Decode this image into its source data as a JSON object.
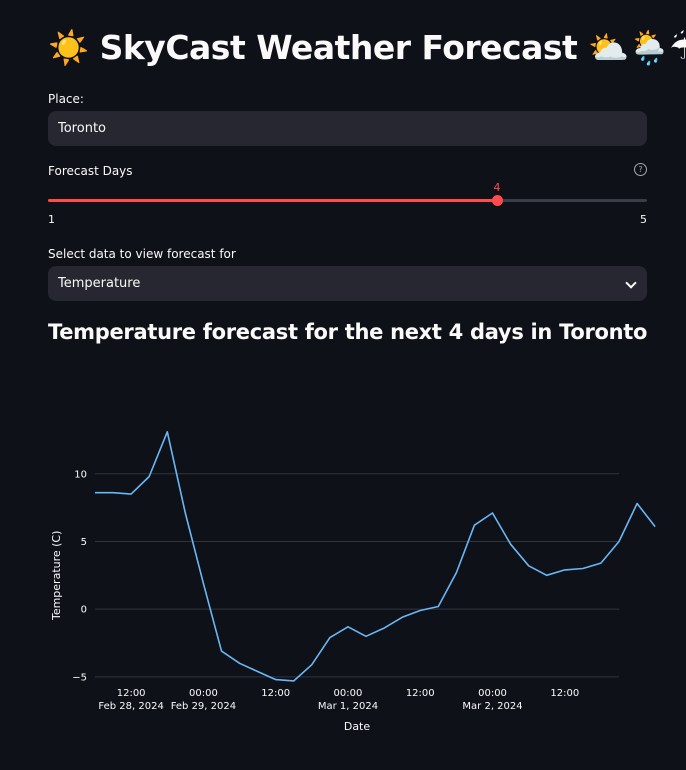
{
  "header": {
    "icon": "☀️",
    "title": "SkyCast Weather Forecast",
    "trailing_icons": "⛅🌦️☔"
  },
  "place": {
    "label": "Place:",
    "value": "Toronto"
  },
  "forecast_days": {
    "label": "Forecast Days",
    "value": 4,
    "value_text": "4",
    "min": "1",
    "max": "5",
    "help_icon": "help-circle-icon"
  },
  "data_select": {
    "label": "Select data to view forecast for",
    "selected": "Temperature",
    "icon": "chevron-down-icon"
  },
  "subheader": "Temperature forecast for the next 4 days in Toronto",
  "colors": {
    "accent": "#ff4b4b",
    "line": "#6ab7f5",
    "background": "#0e1117",
    "input_bg": "#262730"
  },
  "chart_data": {
    "type": "line",
    "xlabel": "Date",
    "ylabel": "Temperature (C)",
    "grid": true,
    "ylim": [
      -5.6,
      13.6
    ],
    "xlim": [
      "2024-02-28 06:00",
      "2024-03-02 21:00"
    ],
    "x_ticks": [
      {
        "x": "2024-02-28 12:00",
        "label1": "12:00",
        "label2": "Feb 28, 2024"
      },
      {
        "x": "2024-02-29 00:00",
        "label1": "00:00",
        "label2": "Feb 29, 2024"
      },
      {
        "x": "2024-02-29 12:00",
        "label1": "12:00",
        "label2": ""
      },
      {
        "x": "2024-03-01 00:00",
        "label1": "00:00",
        "label2": "Mar 1, 2024"
      },
      {
        "x": "2024-03-01 12:00",
        "label1": "12:00",
        "label2": ""
      },
      {
        "x": "2024-03-02 00:00",
        "label1": "00:00",
        "label2": "Mar 2, 2024"
      },
      {
        "x": "2024-03-02 12:00",
        "label1": "12:00",
        "label2": ""
      }
    ],
    "y_ticks": [
      {
        "y": 10,
        "label": "10"
      },
      {
        "y": 5,
        "label": "5"
      },
      {
        "y": 0,
        "label": "0"
      },
      {
        "y": -5,
        "label": "−5"
      }
    ],
    "x": [
      "2024-02-28 06:00",
      "2024-02-28 09:00",
      "2024-02-28 12:00",
      "2024-02-28 15:00",
      "2024-02-28 18:00",
      "2024-02-28 21:00",
      "2024-02-29 00:00",
      "2024-02-29 03:00",
      "2024-02-29 06:00",
      "2024-02-29 09:00",
      "2024-02-29 12:00",
      "2024-02-29 15:00",
      "2024-02-29 18:00",
      "2024-02-29 21:00",
      "2024-03-01 00:00",
      "2024-03-01 03:00",
      "2024-03-01 06:00",
      "2024-03-01 09:00",
      "2024-03-01 12:00",
      "2024-03-01 15:00",
      "2024-03-01 18:00",
      "2024-03-01 21:00",
      "2024-03-02 00:00",
      "2024-03-02 03:00",
      "2024-03-02 06:00",
      "2024-03-02 09:00",
      "2024-03-02 12:00",
      "2024-03-02 15:00",
      "2024-03-02 18:00",
      "2024-03-02 21:00",
      "2024-03-03 00:00",
      "2024-03-03 03:00"
    ],
    "series": [
      {
        "values": [
          8.6,
          8.6,
          8.5,
          9.8,
          13.1,
          7.1,
          1.9,
          -3.1,
          -4.0,
          -4.6,
          -5.2,
          -5.3,
          -4.1,
          -2.1,
          -1.3,
          -2.0,
          -1.4,
          -0.6,
          -0.1,
          0.2,
          2.7,
          6.2,
          7.1,
          4.8,
          3.2,
          2.5,
          2.9,
          3.0,
          3.4,
          5.0,
          7.8,
          6.1
        ]
      }
    ]
  }
}
